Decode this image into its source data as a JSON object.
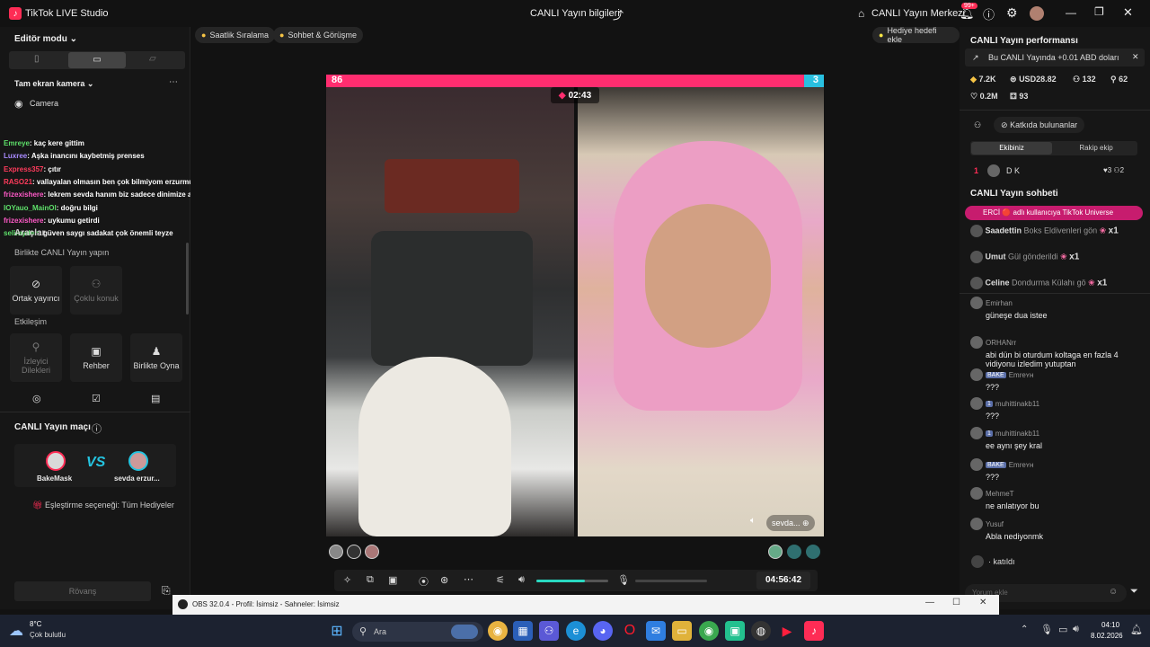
{
  "titlebar": {
    "app_name": "TikTok LIVE Studio",
    "center_title": "CANLI Yayın bilgileri",
    "live_center": "CANLI Yayın Merkezi",
    "notif_badge": "99+"
  },
  "left": {
    "editor_mode": "Editör modu",
    "scene": "Tam ekran kamera",
    "source_camera": "Camera",
    "tools_label": "Araçlar",
    "collab_label": "Birlikte CANLI Yayın yapın",
    "cohost": "Ortak yayıncı",
    "multi_guest": "Çoklu konuk",
    "interaction_label": "Etkileşim",
    "viewer_requests": "İzleyici Dilekleri",
    "guide": "Rehber",
    "play_together": "Birlikte Oyna",
    "match_title": "CANLI Yayın maçı",
    "player1": "BakeMask",
    "player2": "sevda erzur...",
    "match_option": "Eşleştirme seçeneği: Tüm Hediyeler",
    "rematch": "Rövanş",
    "chat_overlay": [
      {
        "user": "Emreye",
        "text": ": kaç kere gittim",
        "color": "#5ee06a"
      },
      {
        "user": "Luxree",
        "text": ": Aşka inancını kaybetmiş prenses",
        "color": "#a98bff"
      },
      {
        "user": "Express357",
        "text": ": çıtır",
        "color": "#ff3b5c"
      },
      {
        "user": "RASO21",
        "text": ": vallayalan olmasın ben çok bilmiyom erzurmu sen neresindensin ama",
        "color": "#ff3b5c"
      },
      {
        "user": "frizexishere",
        "text": ": lekrem sevda hanım biz sadece dinimize aşığız",
        "color": "#ff5ac8"
      },
      {
        "user": "IOYauo_MainOl",
        "text": ": doğru bilgi",
        "color": "#5ee06a"
      },
      {
        "user": "frizexishere",
        "text": ": uykumu getirdi",
        "color": "#ff5ac8"
      },
      {
        "user": "selimyden",
        "text": ": güven saygı sadakat çok önemli teyze",
        "color": "#5ee06a"
      }
    ]
  },
  "stage": {
    "chip_hourly": "Saatlik Sıralama",
    "chip_chat": "Sohbet & Görüşme",
    "chip_gift_goal": "Hediye hedefi ekle",
    "score_left": "86",
    "score_right": "3",
    "timer": "02:43",
    "guest_label": "sevda...",
    "duration": "04:56:42",
    "volume_level": 0.68
  },
  "right": {
    "perf_title": "CANLI Yayın performansı",
    "banner": "Bu CANLI Yayında +0.01 ABD doları",
    "stats": {
      "likes": "7.2K",
      "usd": "USD28.82",
      "viewers": "132",
      "followers": "62",
      "hearts": "0.2M",
      "gifters": "93"
    },
    "contributors": "Katkıda bulunanlar",
    "tab_mine": "Ekibiniz",
    "tab_rival": "Rakip ekip",
    "rank_num": "1",
    "rank_name": "D K",
    "rank_score1": "3",
    "rank_score2": "2",
    "chat_title": "CANLI Yayın sohbeti",
    "pinned": "ERCİ 🔴 adlı kullanıcıya TikTok Universe",
    "gifts": [
      {
        "user": "Saadettin",
        "gift": "Boks Eldivenleri gön",
        "count": "x1"
      },
      {
        "user": "Umut",
        "gift": "Gül gönderildi",
        "count": "x1"
      },
      {
        "user": "Celine",
        "gift": "Dondurma Külahı gö",
        "count": "x1"
      }
    ],
    "messages": [
      {
        "user": "Emirhan",
        "text": "güneşe dua istee",
        "badge": ""
      },
      {
        "user": "ORHANrr",
        "text": "abi dün bi oturdum koltaga en fazla 4 vidiyonu izledim yutuptan",
        "badge": ""
      },
      {
        "user": "Emreʏʜ",
        "text": "???",
        "badge": "BAKE"
      },
      {
        "user": "muhittinakb11",
        "text": "???",
        "badge": "1"
      },
      {
        "user": "muhittinakb11",
        "text": "ee aynı şey kral",
        "badge": "1"
      },
      {
        "user": "Emreʏʜ",
        "text": "???",
        "badge": "BAKE"
      },
      {
        "user": "MehmeT",
        "text": "ne anlatıyor bu",
        "badge": ""
      },
      {
        "user": "Yusuf",
        "text": "Abla nediyonmk",
        "badge": ""
      }
    ],
    "joined": "katıldı",
    "comment_placeholder": "Yorum ekle"
  },
  "obs": {
    "title": "OBS 32.0.4 - Profil: İsimsiz - Sahneler: İsimsiz"
  },
  "taskbar": {
    "weather_temp": "8°C",
    "weather_desc": "Çok bulutlu",
    "search": "Ara",
    "time": "04:10",
    "date": "8.02.2026"
  }
}
